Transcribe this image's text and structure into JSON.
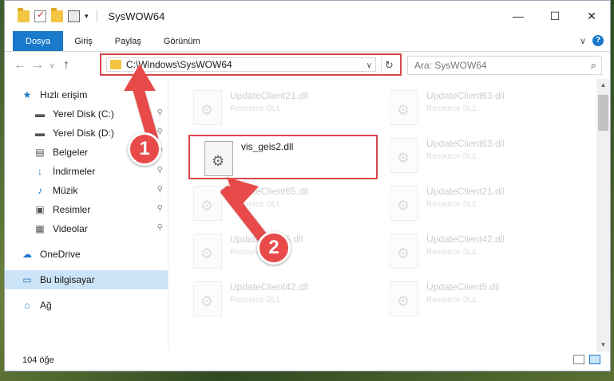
{
  "window": {
    "title": "SysWOW64",
    "minimize": "—",
    "maximize": "☐",
    "close": "✕"
  },
  "ribbon": {
    "tabs": [
      "Dosya",
      "Giriş",
      "Paylaş",
      "Görünüm"
    ],
    "toggle": "∨",
    "help": "?"
  },
  "address": {
    "path": "C:\\Windows\\SysWOW64",
    "dropdown": "∨",
    "refresh": "↻"
  },
  "search": {
    "placeholder": "Ara: SysWOW64",
    "icon": "⌕"
  },
  "nav": {
    "back": "←",
    "forward": "→",
    "recent": "∨",
    "up": "↑"
  },
  "sidebar": {
    "items": [
      {
        "label": "Hızlı erişim",
        "icon": "★",
        "color": "#1979ca"
      },
      {
        "label": "Yerel Disk (C:)",
        "icon": "▬",
        "color": "#555555",
        "pin": "📌"
      },
      {
        "label": "Yerel Disk (D:)",
        "icon": "▬",
        "color": "#555555",
        "pin": "📌"
      },
      {
        "label": "Belgeler",
        "icon": "▤",
        "color": "#555555",
        "pin": "📌"
      },
      {
        "label": "İndirmeler",
        "icon": "↓",
        "color": "#1979ca",
        "pin": "📌"
      },
      {
        "label": "Müzik",
        "icon": "♪",
        "color": "#1979ca",
        "pin": "📌"
      },
      {
        "label": "Resimler",
        "icon": "▣",
        "color": "#555555",
        "pin": "📌"
      },
      {
        "label": "Videolar",
        "icon": "▦",
        "color": "#555555",
        "pin": "📌"
      },
      {
        "label": "OneDrive",
        "icon": "☁",
        "color": "#1979ca"
      },
      {
        "label": "Bu bilgisayar",
        "icon": "▭",
        "color": "#1979ca"
      },
      {
        "label": "Ağ",
        "icon": "⌂",
        "color": "#1979ca"
      }
    ]
  },
  "files": [
    {
      "name": "UpdateClient21.dll",
      "type": "Resource DLL"
    },
    {
      "name": "UpdateClient63.dll",
      "type": "Resource DLL"
    },
    {
      "name": "vis_geis2.dll",
      "type": ""
    },
    {
      "name": "UpdateClient63.dll",
      "type": "Resource DLL"
    },
    {
      "name": "UpdateClient65.dll",
      "type": "Resource DLL"
    },
    {
      "name": "UpdateClient21.dll",
      "type": "Resource DLL"
    },
    {
      "name": "UpdateClient5.dll",
      "type": "Resource DLL"
    },
    {
      "name": "UpdateClient42.dll",
      "type": "Resource DLL"
    },
    {
      "name": "UpdateClient42.dll",
      "type": "Resource DLL"
    },
    {
      "name": "UpdateClient5.dll",
      "type": "Resource DLL"
    }
  ],
  "status": {
    "count": "104 öğe"
  },
  "annotations": {
    "badge1": "1",
    "badge2": "2",
    "color": "#e84a4a"
  }
}
